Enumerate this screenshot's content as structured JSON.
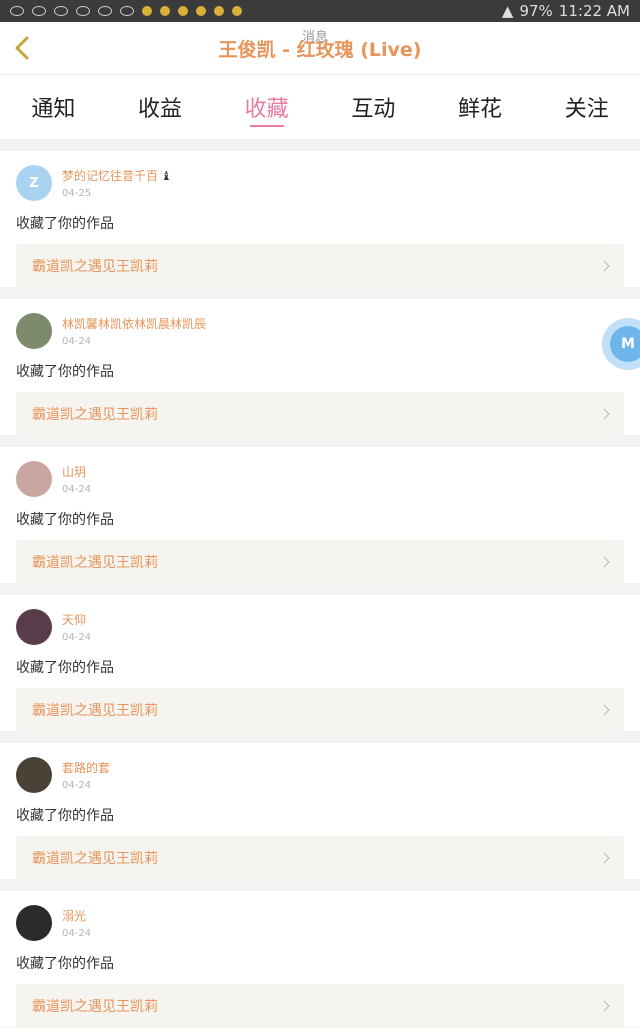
{
  "status_bar": {
    "battery": "97%",
    "time": "11:22 AM"
  },
  "header": {
    "title": "王俊凯 - 红玫瑰 (Live)",
    "subtitle": "消息"
  },
  "tabs": [
    {
      "label": "通知",
      "active": false
    },
    {
      "label": "收益",
      "active": false
    },
    {
      "label": "收藏",
      "active": true
    },
    {
      "label": "互动",
      "active": false
    },
    {
      "label": "鲜花",
      "active": false
    },
    {
      "label": "关注",
      "active": false
    }
  ],
  "colors": {
    "accent": "#e97aa2",
    "name": "#e8945a"
  },
  "notifications": [
    {
      "user": "梦的记忆往昔千百",
      "date": "04-25",
      "message": "收藏了你的作品",
      "work": "霸道凯之遇见王凯莉",
      "avatar_color": "#a9d3f0",
      "avatar_text": "Z"
    },
    {
      "user": "林凯馨林凯依林凯晨林凯辰",
      "date": "04-24",
      "message": "收藏了你的作品",
      "work": "霸道凯之遇见王凯莉",
      "avatar_color": "#7d8a6b",
      "avatar_text": ""
    },
    {
      "user": "山玥",
      "date": "04-24",
      "message": "收藏了你的作品",
      "work": "霸道凯之遇见王凯莉",
      "avatar_color": "#c9a7a0",
      "avatar_text": ""
    },
    {
      "user": "天仰",
      "date": "04-24",
      "message": "收藏了你的作品",
      "work": "霸道凯之遇见王凯莉",
      "avatar_color": "#5a3b4a",
      "avatar_text": ""
    },
    {
      "user": "套路的套",
      "date": "04-24",
      "message": "收藏了你的作品",
      "work": "霸道凯之遇见王凯莉",
      "avatar_color": "#4a4236",
      "avatar_text": ""
    },
    {
      "user": "溺光",
      "date": "04-24",
      "message": "收藏了你的作品",
      "work": "霸道凯之遇见王凯莉",
      "avatar_color": "#2b2b2b",
      "avatar_text": ""
    }
  ],
  "float_button": {
    "label": "M"
  }
}
